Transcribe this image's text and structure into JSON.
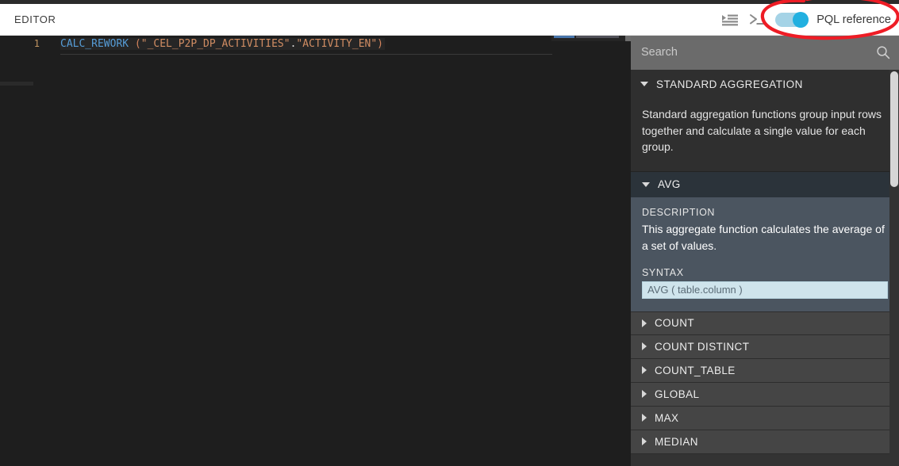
{
  "header": {
    "title": "EDITOR",
    "icons": [
      {
        "name": "format-indent-icon"
      },
      {
        "name": "console-prompt-icon"
      }
    ],
    "toggle": {
      "label": "PQL reference",
      "state": "on",
      "track_color": "#a5d3e6",
      "knob_color": "#22b0e0"
    },
    "annotation": {
      "name": "red-ellipse-highlight",
      "color": "#ee1c25"
    }
  },
  "editor": {
    "line_number": "1",
    "code": {
      "function": "CALC_REWORK",
      "open_paren": " (",
      "table": "\"_CEL_P2P_DP_ACTIVITIES\"",
      "dot": ".",
      "column": "\"ACTIVITY_EN\"",
      "close_paren": ")",
      "full_text": "CALC_REWORK (\"_CEL_P2P_DP_ACTIVITIES\".\"ACTIVITY_EN\")"
    },
    "colors": {
      "background": "#1e1e1e",
      "function": "#569cd6",
      "string": "#d18d63",
      "line_number": "#c29662"
    }
  },
  "sidebar": {
    "search": {
      "placeholder": "Search",
      "value": "",
      "icon": "search-icon"
    },
    "section": {
      "label": "STANDARD AGGREGATION",
      "expanded": true,
      "description": "Standard aggregation functions group input rows together and calculate a single value for each group."
    },
    "expanded_function": {
      "name": "AVG",
      "expanded": true,
      "description_label": "DESCRIPTION",
      "description": "This aggregate function calculates the average of a set of values.",
      "syntax_label": "SYNTAX",
      "syntax": "AVG ( table.column )"
    },
    "functions": [
      {
        "label": "COUNT",
        "expanded": false
      },
      {
        "label": "COUNT DISTINCT",
        "expanded": false
      },
      {
        "label": "COUNT_TABLE",
        "expanded": false
      },
      {
        "label": "GLOBAL",
        "expanded": false
      },
      {
        "label": "MAX",
        "expanded": false
      },
      {
        "label": "MEDIAN",
        "expanded": false
      }
    ]
  }
}
